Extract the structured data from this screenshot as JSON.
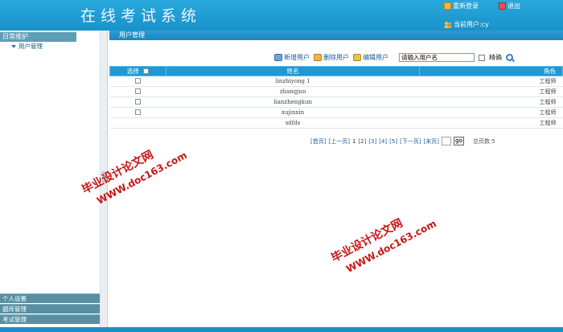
{
  "header": {
    "title": "在线考试系统",
    "relogin_label": "重新登录",
    "exit_label": "退出",
    "current_user_label": "当前用户:cy"
  },
  "sidebar": {
    "section_title": "日常维护",
    "items": [
      {
        "label": "用户管理"
      }
    ],
    "bottom_sections": [
      {
        "label": "个人设置"
      },
      {
        "label": "题库管理"
      },
      {
        "label": "考试管理"
      }
    ]
  },
  "main": {
    "title": "用户管理",
    "toolbar": {
      "add_label": "新增用户",
      "delete_label": "删除用户",
      "edit_label": "编辑用户",
      "search_value": "请输入用户名",
      "exact_label": "精确"
    },
    "table": {
      "columns": [
        "选择",
        "姓名",
        "角色"
      ],
      "rows": [
        {
          "name": "linzhiyong 1",
          "role": "工程师"
        },
        {
          "name": "zhangjun",
          "role": "工程师"
        },
        {
          "name": "lianzhengkun",
          "role": "工程师"
        },
        {
          "name": "xujinxin",
          "role": "工程师"
        },
        {
          "name": "sdfds",
          "role": "工程师"
        }
      ]
    },
    "pager": {
      "first": "[首页]",
      "prev": "[上一页]",
      "current": "1",
      "pages": [
        "[2]",
        "[3]",
        "[4]",
        "[5]"
      ],
      "next": "[下一页]",
      "last": "[末页]",
      "go_label": "go",
      "total_label": "总页数:5"
    }
  },
  "watermarks": [
    {
      "line1": "毕业设计论文网",
      "line2": "WWW.doc163.com"
    },
    {
      "line1": "毕业设计论文网",
      "line2": "WWW.doc163.com"
    }
  ],
  "colors": {
    "header": "#1a92c9",
    "accent": "#1d9ad6",
    "sidebar_head": "#5f9fb6",
    "watermark": "#c81414"
  }
}
